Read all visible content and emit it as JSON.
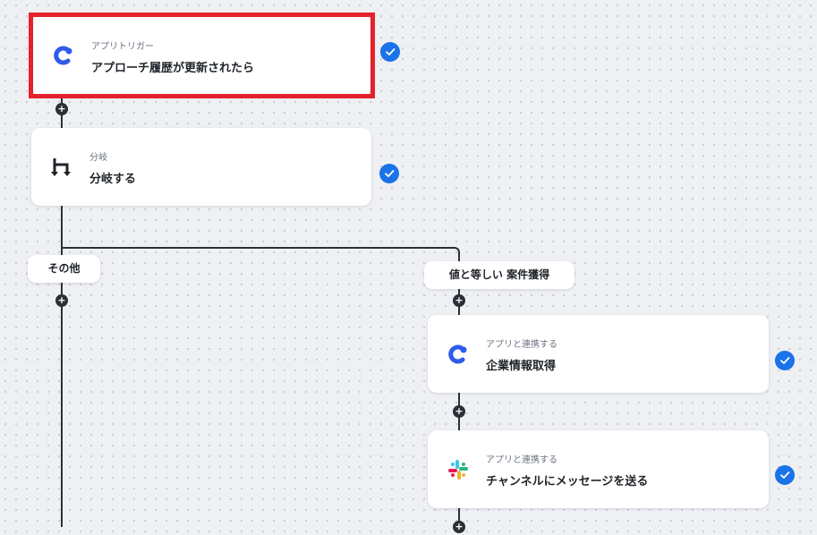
{
  "trigger": {
    "type_label": "アプリトリガー",
    "title": "アプローチ履歴が更新されたら",
    "icon": "app-c-logo-icon"
  },
  "branch": {
    "type_label": "分岐",
    "title": "分岐する",
    "icon": "branch-icon"
  },
  "branch_labels": {
    "other": "その他",
    "equal": "値と等しい 案件獲得"
  },
  "step_company": {
    "type_label": "アプリと連携する",
    "title": "企業情報取得",
    "icon": "app-c-logo-icon"
  },
  "step_slack": {
    "type_label": "アプリと連携する",
    "title": "チャンネルにメッセージを送る",
    "icon": "slack-icon"
  },
  "colors": {
    "accent": "#1a73e8",
    "selection": "#e3222b",
    "connector": "#2b2f36",
    "logo_blue": "#2f5bea"
  }
}
